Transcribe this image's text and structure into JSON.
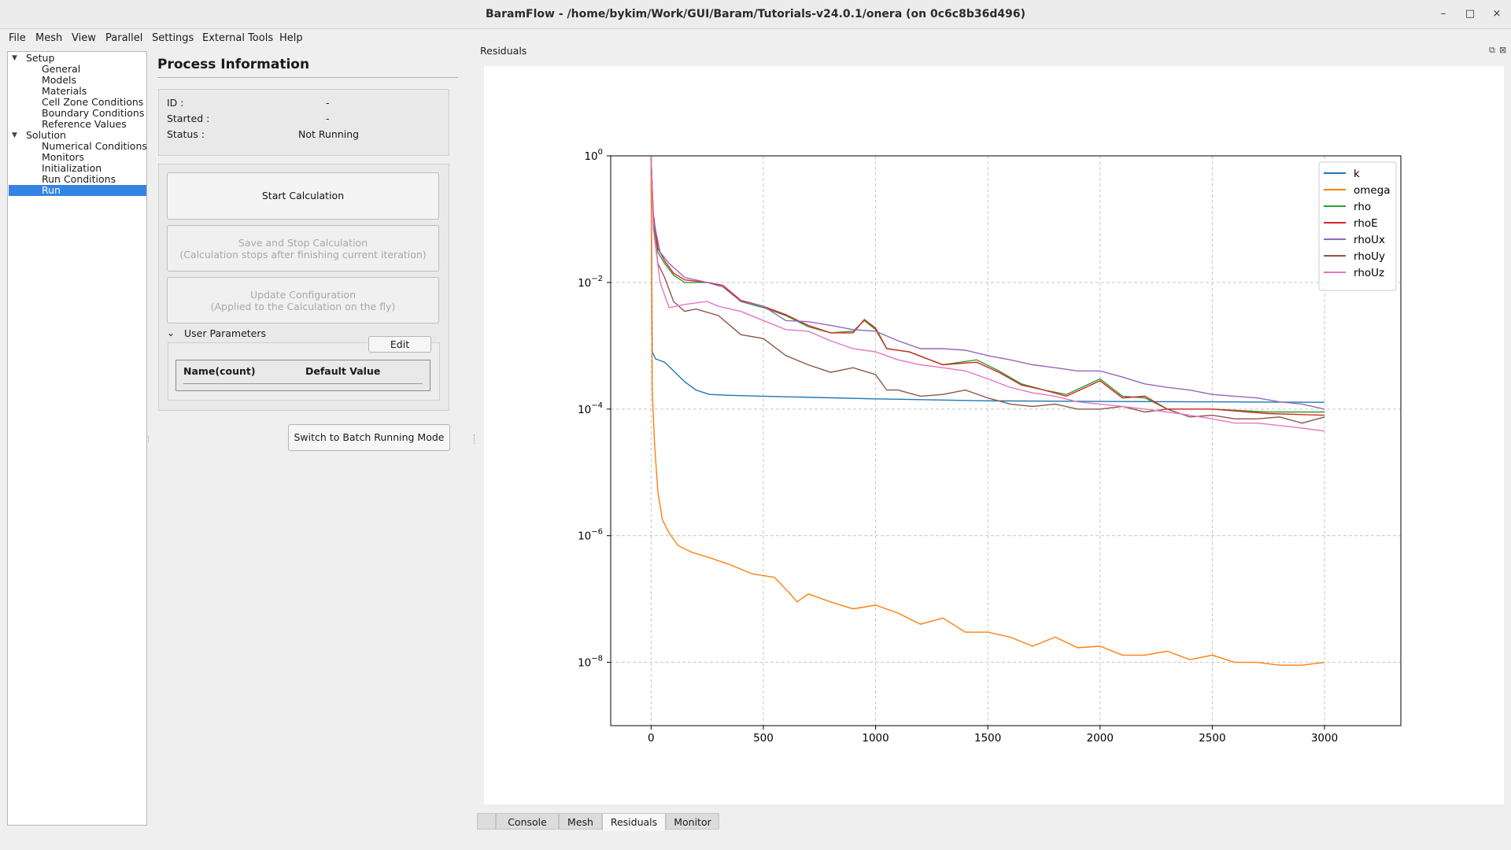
{
  "window": {
    "title": "BaramFlow - /home/bykim/Work/GUI/Baram/Tutorials-v24.0.1/onera (on 0c6c8b36d496)",
    "controls": {
      "minimize": "–",
      "maximize": "□",
      "close": "×"
    }
  },
  "menu": [
    "File",
    "Mesh",
    "View",
    "Parallel",
    "Settings",
    "External Tools",
    "Help"
  ],
  "tree": {
    "setup": "Setup",
    "setup_items": [
      "General",
      "Models",
      "Materials",
      "Cell Zone Conditions",
      "Boundary Conditions",
      "Reference Values"
    ],
    "solution": "Solution",
    "solution_items": [
      "Numerical Conditions",
      "Monitors",
      "Initialization",
      "Run Conditions",
      "Run"
    ],
    "selected": "Run"
  },
  "process": {
    "title": "Process Information",
    "id_label": "ID :",
    "id_value": "-",
    "started_label": "Started :",
    "started_value": "-",
    "status_label": "Status :",
    "status_value": "Not Running"
  },
  "buttons": {
    "start": "Start Calculation",
    "save_stop": "Save and Stop Calculation",
    "save_stop_sub": "(Calculation stops after finishing current iteration)",
    "update": "Update Configuration",
    "update_sub": "(Applied to the Calculation on the fly)",
    "batch": "Switch to Batch Running Mode"
  },
  "user_params": {
    "label": "User Parameters",
    "edit": "Edit",
    "col_name": "Name(count)",
    "col_default": "Default Value"
  },
  "dock": {
    "title": "Residuals",
    "float_icon": "⧉",
    "close_icon": "⊠"
  },
  "bottom_tabs": [
    "",
    "Console",
    "Mesh",
    "Residuals",
    "Monitor"
  ],
  "active_tab": "Residuals",
  "chart_data": {
    "type": "line",
    "title": "",
    "xlabel": "",
    "ylabel": "",
    "yscale": "log",
    "xlim": [
      -180,
      3340
    ],
    "ylim": [
      1e-09,
      1
    ],
    "xticks": [
      0,
      500,
      1000,
      1500,
      2000,
      2500,
      3000
    ],
    "yticks": [
      1,
      0.01,
      0.0001,
      1e-06,
      1e-08
    ],
    "ytick_labels": [
      {
        "base": "10",
        "exp": "0"
      },
      {
        "base": "10",
        "exp": "−2"
      },
      {
        "base": "10",
        "exp": "−4"
      },
      {
        "base": "10",
        "exp": "−6"
      },
      {
        "base": "10",
        "exp": "−8"
      }
    ],
    "grid": true,
    "legend": "top-right",
    "series": [
      {
        "name": "k",
        "color": "#1f77b4",
        "points": [
          [
            0,
            1
          ],
          [
            5,
            0.0008
          ],
          [
            20,
            0.00062
          ],
          [
            60,
            0.00055
          ],
          [
            100,
            0.0004
          ],
          [
            150,
            0.00027
          ],
          [
            200,
            0.0002
          ],
          [
            260,
            0.00017
          ],
          [
            350,
            0.000165
          ],
          [
            500,
            0.00016
          ],
          [
            1000,
            0.000145
          ],
          [
            1500,
            0.000135
          ],
          [
            2000,
            0.000132
          ],
          [
            2500,
            0.00013
          ],
          [
            3000,
            0.000128
          ]
        ]
      },
      {
        "name": "omega",
        "color": "#ff7f0e",
        "points": [
          [
            0,
            1
          ],
          [
            5,
            0.0002
          ],
          [
            15,
            3e-05
          ],
          [
            30,
            5e-06
          ],
          [
            50,
            1.8e-06
          ],
          [
            80,
            1.1e-06
          ],
          [
            120,
            7e-07
          ],
          [
            180,
            5.5e-07
          ],
          [
            260,
            4.5e-07
          ],
          [
            350,
            3.5e-07
          ],
          [
            450,
            2.5e-07
          ],
          [
            550,
            2.2e-07
          ],
          [
            620,
            1.2e-07
          ],
          [
            650,
            9e-08
          ],
          [
            700,
            1.2e-07
          ],
          [
            800,
            9e-08
          ],
          [
            900,
            7e-08
          ],
          [
            1000,
            8e-08
          ],
          [
            1100,
            6e-08
          ],
          [
            1200,
            4e-08
          ],
          [
            1300,
            5e-08
          ],
          [
            1400,
            3e-08
          ],
          [
            1500,
            3e-08
          ],
          [
            1600,
            2.5e-08
          ],
          [
            1700,
            1.8e-08
          ],
          [
            1800,
            2.5e-08
          ],
          [
            1900,
            1.7e-08
          ],
          [
            2000,
            1.8e-08
          ],
          [
            2100,
            1.3e-08
          ],
          [
            2200,
            1.3e-08
          ],
          [
            2300,
            1.5e-08
          ],
          [
            2400,
            1.1e-08
          ],
          [
            2500,
            1.3e-08
          ],
          [
            2600,
            1e-08
          ],
          [
            2700,
            1e-08
          ],
          [
            2800,
            9e-09
          ],
          [
            2900,
            9e-09
          ],
          [
            3000,
            1e-08
          ]
        ]
      },
      {
        "name": "rho",
        "color": "#2ca02c",
        "points": [
          [
            0,
            1
          ],
          [
            10,
            0.1
          ],
          [
            30,
            0.03
          ],
          [
            60,
            0.02
          ],
          [
            100,
            0.013
          ],
          [
            150,
            0.01
          ],
          [
            250,
            0.01
          ],
          [
            320,
            0.009
          ],
          [
            400,
            0.005
          ],
          [
            500,
            0.004
          ],
          [
            600,
            0.003
          ],
          [
            700,
            0.002
          ],
          [
            800,
            0.0016
          ],
          [
            900,
            0.0017
          ],
          [
            950,
            0.0025
          ],
          [
            1000,
            0.0018
          ],
          [
            1050,
            0.0009
          ],
          [
            1150,
            0.0008
          ],
          [
            1300,
            0.0005
          ],
          [
            1450,
            0.0006
          ],
          [
            1550,
            0.0004
          ],
          [
            1650,
            0.00025
          ],
          [
            1750,
            0.0002
          ],
          [
            1850,
            0.00017
          ],
          [
            2000,
            0.0003
          ],
          [
            2100,
            0.00016
          ],
          [
            2200,
            0.00015
          ],
          [
            2300,
            0.0001
          ],
          [
            2500,
            0.0001
          ],
          [
            2750,
            9e-05
          ],
          [
            3000,
            9e-05
          ]
        ]
      },
      {
        "name": "rhoE",
        "color": "#d62728",
        "points": [
          [
            0,
            1
          ],
          [
            10,
            0.12
          ],
          [
            30,
            0.035
          ],
          [
            60,
            0.022
          ],
          [
            100,
            0.014
          ],
          [
            150,
            0.011
          ],
          [
            250,
            0.01
          ],
          [
            320,
            0.009
          ],
          [
            400,
            0.0052
          ],
          [
            500,
            0.0042
          ],
          [
            600,
            0.0031
          ],
          [
            700,
            0.0021
          ],
          [
            800,
            0.0016
          ],
          [
            900,
            0.0016
          ],
          [
            950,
            0.0026
          ],
          [
            1000,
            0.0019
          ],
          [
            1050,
            0.0009
          ],
          [
            1150,
            0.0008
          ],
          [
            1300,
            0.0005
          ],
          [
            1450,
            0.00055
          ],
          [
            1550,
            0.00038
          ],
          [
            1650,
            0.00024
          ],
          [
            1750,
            0.0002
          ],
          [
            1850,
            0.00016
          ],
          [
            2000,
            0.00028
          ],
          [
            2100,
            0.00015
          ],
          [
            2200,
            0.00016
          ],
          [
            2300,
            0.0001
          ],
          [
            2500,
            0.0001
          ],
          [
            2750,
            8.5e-05
          ],
          [
            3000,
            8e-05
          ]
        ]
      },
      {
        "name": "rhoUx",
        "color": "#9467bd",
        "points": [
          [
            0,
            1
          ],
          [
            10,
            0.1
          ],
          [
            40,
            0.03
          ],
          [
            80,
            0.02
          ],
          [
            150,
            0.012
          ],
          [
            250,
            0.01
          ],
          [
            320,
            0.0085
          ],
          [
            400,
            0.005
          ],
          [
            500,
            0.0042
          ],
          [
            600,
            0.0025
          ],
          [
            700,
            0.0024
          ],
          [
            800,
            0.0021
          ],
          [
            900,
            0.0018
          ],
          [
            1000,
            0.0017
          ],
          [
            1100,
            0.0012
          ],
          [
            1200,
            0.0009
          ],
          [
            1300,
            0.0009
          ],
          [
            1400,
            0.00085
          ],
          [
            1500,
            0.0007
          ],
          [
            1600,
            0.0006
          ],
          [
            1700,
            0.0005
          ],
          [
            1800,
            0.00045
          ],
          [
            1900,
            0.0004
          ],
          [
            2000,
            0.0004
          ],
          [
            2100,
            0.00032
          ],
          [
            2200,
            0.00025
          ],
          [
            2300,
            0.00022
          ],
          [
            2400,
            0.0002
          ],
          [
            2500,
            0.00017
          ],
          [
            2600,
            0.00016
          ],
          [
            2700,
            0.00015
          ],
          [
            2800,
            0.00013
          ],
          [
            2900,
            0.00012
          ],
          [
            3000,
            0.0001
          ]
        ]
      },
      {
        "name": "rhoUy",
        "color": "#8c564b",
        "points": [
          [
            0,
            1
          ],
          [
            10,
            0.08
          ],
          [
            30,
            0.02
          ],
          [
            60,
            0.012
          ],
          [
            100,
            0.005
          ],
          [
            150,
            0.0035
          ],
          [
            200,
            0.0038
          ],
          [
            300,
            0.003
          ],
          [
            400,
            0.0015
          ],
          [
            500,
            0.0013
          ],
          [
            600,
            0.0007
          ],
          [
            700,
            0.0005
          ],
          [
            800,
            0.00038
          ],
          [
            900,
            0.00045
          ],
          [
            1000,
            0.00035
          ],
          [
            1050,
            0.0002
          ],
          [
            1100,
            0.0002
          ],
          [
            1200,
            0.00016
          ],
          [
            1300,
            0.00017
          ],
          [
            1400,
            0.0002
          ],
          [
            1500,
            0.00015
          ],
          [
            1600,
            0.00012
          ],
          [
            1700,
            0.00011
          ],
          [
            1800,
            0.00012
          ],
          [
            1900,
            0.0001
          ],
          [
            2000,
            0.0001
          ],
          [
            2100,
            0.00011
          ],
          [
            2200,
            9e-05
          ],
          [
            2300,
            0.0001
          ],
          [
            2400,
            7.5e-05
          ],
          [
            2500,
            8e-05
          ],
          [
            2600,
            7e-05
          ],
          [
            2700,
            7e-05
          ],
          [
            2800,
            7.5e-05
          ],
          [
            2900,
            6e-05
          ],
          [
            3000,
            7.5e-05
          ]
        ]
      },
      {
        "name": "rhoUz",
        "color": "#e377c2",
        "points": [
          [
            0,
            1
          ],
          [
            10,
            0.07
          ],
          [
            40,
            0.01
          ],
          [
            80,
            0.004
          ],
          [
            150,
            0.0045
          ],
          [
            250,
            0.005
          ],
          [
            300,
            0.0042
          ],
          [
            400,
            0.0035
          ],
          [
            500,
            0.0025
          ],
          [
            600,
            0.0018
          ],
          [
            700,
            0.0017
          ],
          [
            800,
            0.0012
          ],
          [
            900,
            0.0009
          ],
          [
            1000,
            0.0008
          ],
          [
            1100,
            0.0006
          ],
          [
            1200,
            0.0005
          ],
          [
            1300,
            0.00045
          ],
          [
            1400,
            0.0004
          ],
          [
            1500,
            0.0003
          ],
          [
            1600,
            0.00022
          ],
          [
            1700,
            0.00018
          ],
          [
            1800,
            0.00016
          ],
          [
            1900,
            0.00013
          ],
          [
            2000,
            0.00012
          ],
          [
            2100,
            0.00011
          ],
          [
            2200,
            0.0001
          ],
          [
            2300,
            9e-05
          ],
          [
            2400,
            8e-05
          ],
          [
            2500,
            7e-05
          ],
          [
            2600,
            6e-05
          ],
          [
            2700,
            6e-05
          ],
          [
            2800,
            5.5e-05
          ],
          [
            2900,
            5e-05
          ],
          [
            3000,
            4.5e-05
          ]
        ]
      }
    ]
  }
}
